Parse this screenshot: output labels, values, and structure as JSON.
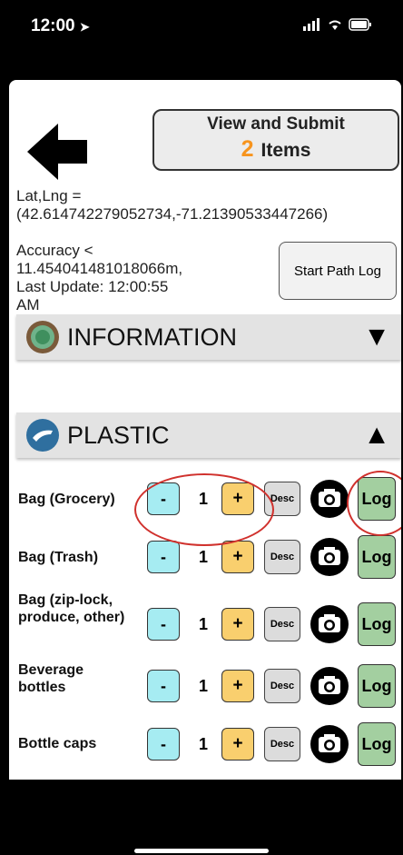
{
  "status": {
    "time": "12:00"
  },
  "header": {
    "submit_title": "View and Submit",
    "submit_count": "2",
    "submit_unit": "Items"
  },
  "location": {
    "latlng_label": "Lat,Lng =",
    "latlng_value": "(42.614742279052734,-71.21390533447266)",
    "accuracy_line1": "Accuracy <",
    "accuracy_line2": "11.454041481018066m,",
    "accuracy_line3": "Last Update: 12:00:55",
    "accuracy_line4": "AM",
    "start_path_label": "Start Path Log"
  },
  "sections": [
    {
      "label": "INFORMATION",
      "arrow": "▼"
    },
    {
      "label": "PLASTIC",
      "arrow": "▲"
    }
  ],
  "controls": {
    "minus": "-",
    "plus": "+",
    "desc": "Desc",
    "log": "Log"
  },
  "items": [
    {
      "label": "Bag (Grocery)",
      "qty": "1"
    },
    {
      "label": "Bag (Trash)",
      "qty": "1"
    },
    {
      "label": "Bag (zip-lock, produce, other)",
      "qty": "1"
    },
    {
      "label": "Beverage bottles",
      "qty": "1"
    },
    {
      "label": "Bottle caps",
      "qty": "1"
    }
  ],
  "colors": {
    "minus_bg": "#a6ecf2",
    "plus_bg": "#f9cf6e",
    "log_bg": "#a3cfa0",
    "count_accent": "#f7941d",
    "annotation": "#d0312d"
  },
  "icons": [
    "back-arrow-icon",
    "information-globe-icon",
    "plastic-hand-icon",
    "camera-icon",
    "signal-icon",
    "wifi-icon",
    "battery-icon",
    "location-arrow-icon"
  ]
}
